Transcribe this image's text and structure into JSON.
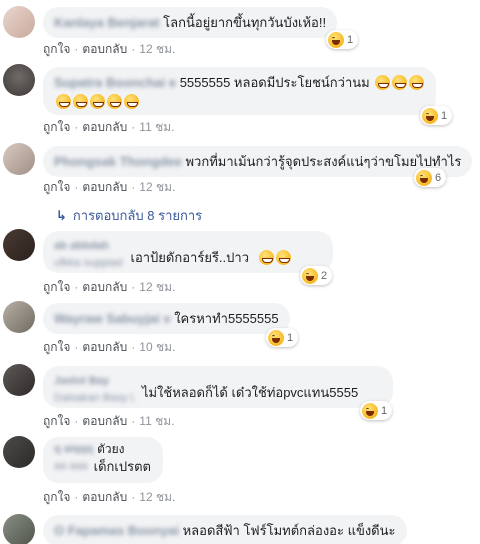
{
  "actions": {
    "like": "ถูกใจ",
    "reply": "ตอบกลับ"
  },
  "replies_link": "การตอบกลับ 8 รายการ",
  "colors": {
    "bubble": "#f2f3f5",
    "link": "#385898",
    "muted": "#90949c"
  },
  "comments": [
    {
      "author": "Kanlaya Benjarat",
      "text": "โลกนี้อยู่ยากขึ้นทุกวันบังเห้อ!!",
      "time": "12 ชม.",
      "reactions": "1"
    },
    {
      "author": "Supatra Boonchai e",
      "text": "5555555 หลอดมีประโยชน์กว่านม",
      "time": "11 ชม.",
      "reactions": "1"
    },
    {
      "author": "Phongsak Thongdee",
      "text": "พวกที่มาเม้นกว่ารู้จุดประสงค์แน่ๆว่าขโมยไปทำไร",
      "time": "12 ชม.",
      "reactions": "6"
    },
    {
      "author": "ab abbdah",
      "author2": "ufkka ouppiad",
      "text": "เอาป้ยดักอาร์ยรี..ปาว",
      "time": "12 ชม.",
      "reactions": "2"
    },
    {
      "author": "Wayraw Sabuyjai v",
      "text": "ใครหาทำ5555555",
      "time": "10 ชม.",
      "reactions": "1"
    },
    {
      "author": "Jaslot Bay",
      "author2": "Daisakan Basy l.",
      "text": "ไม่ใช้หลอดก็ได้ เด๋วใช้ท่อpvcแทน5555",
      "time": "11 ชม.",
      "reactions": "1"
    },
    {
      "author": "q aiqqq",
      "text_line1": "ตัวยง",
      "text": "เด็กเปรตต",
      "time": "12 ชม."
    },
    {
      "author": "O Fapamas Boonyai",
      "text": "หลอดสีฟ้า โฟร์โมทต์กล่องอะ แข็งดีนะ"
    }
  ]
}
